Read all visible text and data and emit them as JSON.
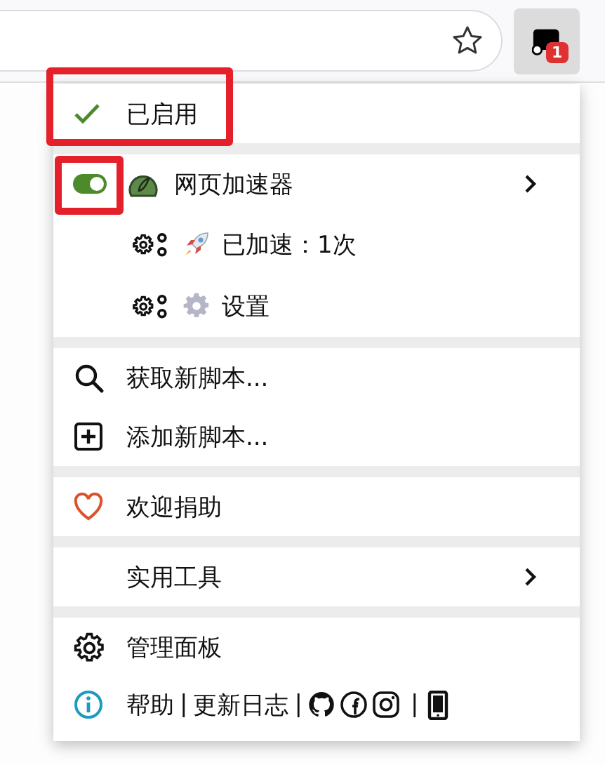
{
  "toolbar": {
    "badge": "1"
  },
  "menu": {
    "status": {
      "label": "已启用",
      "checked": true,
      "highlighted": true
    },
    "scripts": [
      {
        "name": "网页加速器",
        "on": true,
        "highlighted": true,
        "expandable": true,
        "commands": [
          {
            "label": "已加速：1次",
            "kind": "rocket"
          },
          {
            "label": "设置",
            "kind": "gear"
          }
        ]
      }
    ],
    "sections": [
      [
        {
          "label": "获取新脚本...",
          "kind": "search"
        },
        {
          "label": "添加新脚本...",
          "kind": "add"
        }
      ],
      [
        {
          "label": "欢迎捐助",
          "kind": "heart"
        }
      ],
      [
        {
          "label": "实用工具",
          "kind": "submenu"
        }
      ],
      [
        {
          "label": "管理面板",
          "kind": "settings"
        }
      ]
    ],
    "footer": [
      {
        "kind": "text",
        "label": "帮助"
      },
      {
        "kind": "divider",
        "label": "|"
      },
      {
        "kind": "text",
        "label": "更新日志"
      },
      {
        "kind": "divider",
        "label": "|"
      },
      {
        "kind": "github"
      },
      {
        "kind": "facebook"
      },
      {
        "kind": "instagram"
      },
      {
        "kind": "divider",
        "label": "|"
      },
      {
        "kind": "phone"
      }
    ]
  }
}
